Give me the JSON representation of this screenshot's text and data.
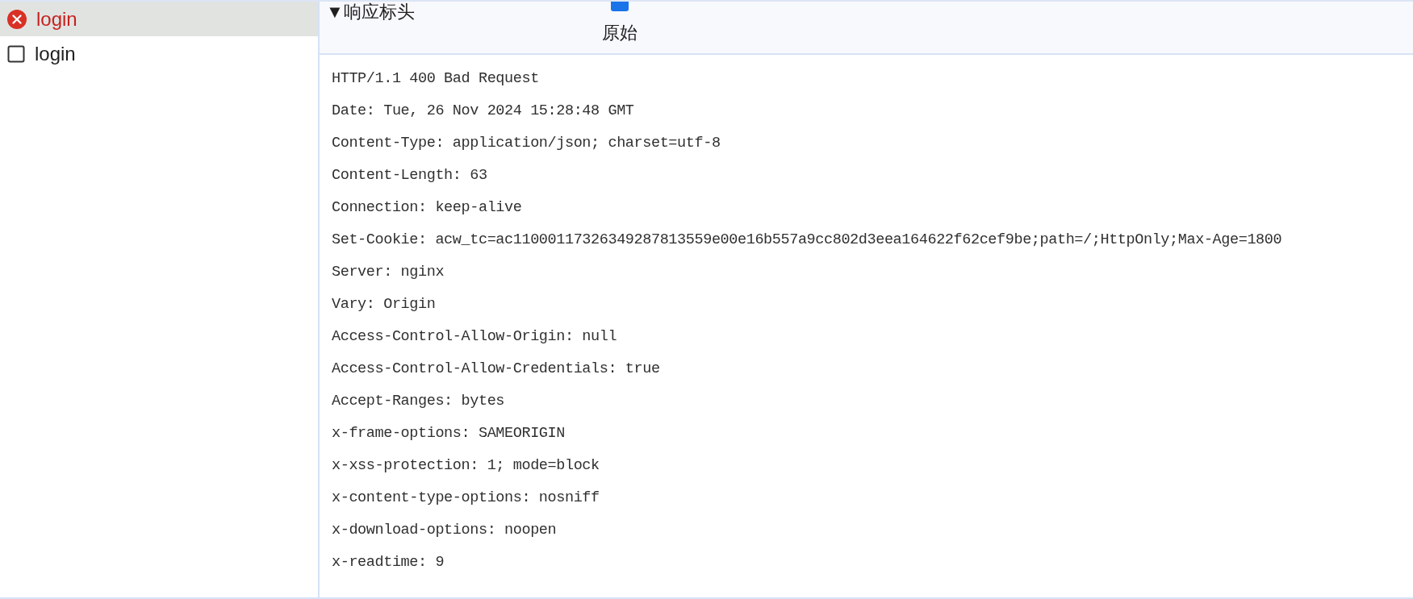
{
  "requests": [
    {
      "name": "login",
      "kind": "error",
      "selected": true
    },
    {
      "name": "login",
      "kind": "plain",
      "selected": false
    }
  ],
  "response_headers": {
    "title": "▼响应标头",
    "raw_toggle": {
      "label": "原始",
      "checked": true
    },
    "lines": [
      "HTTP/1.1 400 Bad Request",
      "Date: Tue, 26 Nov 2024 15:28:48 GMT",
      "Content-Type: application/json; charset=utf-8",
      "Content-Length: 63",
      "Connection: keep-alive",
      "Set-Cookie: acw_tc=ac11000117326349287813559e00e16b557a9cc802d3eea164622f62cef9be;path=/;HttpOnly;Max-Age=1800",
      "Server: nginx",
      "Vary: Origin",
      "Access-Control-Allow-Origin: null",
      "Access-Control-Allow-Credentials: true",
      "Accept-Ranges: bytes",
      "x-frame-options: SAMEORIGIN",
      "x-xss-protection: 1; mode=block",
      "x-content-type-options: nosniff",
      "x-download-options: noopen",
      "x-readtime: 9"
    ]
  }
}
